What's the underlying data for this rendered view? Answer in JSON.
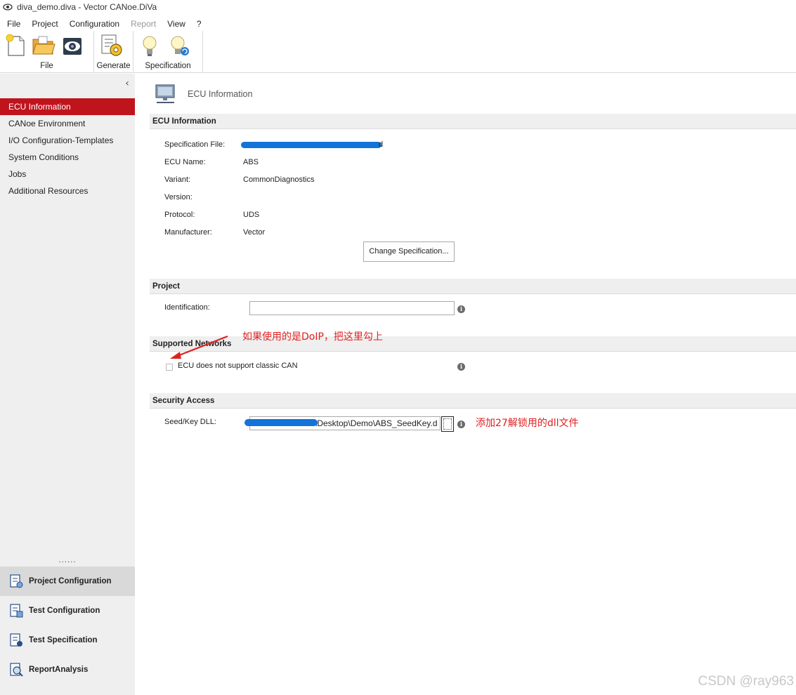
{
  "window": {
    "title": "diva_demo.diva - Vector CANoe.DiVa"
  },
  "menu": [
    {
      "label": "File"
    },
    {
      "label": "Project"
    },
    {
      "label": "Configuration"
    },
    {
      "label": "Report",
      "disabled": true
    },
    {
      "label": "View"
    },
    {
      "label": "?"
    }
  ],
  "ribbon": {
    "file_group": "File",
    "generate_group": "Generate",
    "spec_group": "Specification"
  },
  "sidebar": {
    "items": [
      {
        "label": "ECU Information",
        "active": true
      },
      {
        "label": "CANoe Environment"
      },
      {
        "label": "I/O Configuration-Templates"
      },
      {
        "label": "System Conditions"
      },
      {
        "label": "Jobs"
      },
      {
        "label": "Additional Resources"
      }
    ],
    "dots": "......",
    "bottom": [
      {
        "label": "Project Configuration",
        "icon": "project-config-icon",
        "active": true
      },
      {
        "label": "Test Configuration",
        "icon": "test-config-icon"
      },
      {
        "label": "Test Specification",
        "icon": "test-spec-icon"
      },
      {
        "label": "ReportAnalysis",
        "icon": "report-analysis-icon"
      }
    ]
  },
  "page": {
    "title": "ECU Information"
  },
  "ecu": {
    "header": "ECU Information",
    "spec_file_label": "Specification File:",
    "spec_file_value": "d",
    "ecu_name_label": "ECU Name:",
    "ecu_name_value": "ABS",
    "variant_label": "Variant:",
    "variant_value": "CommonDiagnostics",
    "version_label": "Version:",
    "version_value": "",
    "protocol_label": "Protocol:",
    "protocol_value": "UDS",
    "manufacturer_label": "Manufacturer:",
    "manufacturer_value": "Vector",
    "change_button": "Change Specification..."
  },
  "project": {
    "header": "Project",
    "identification_label": "Identification:",
    "identification_value": ""
  },
  "networks": {
    "header": "Supported Networks",
    "checkbox_label": "ECU does not support classic CAN",
    "checked": false
  },
  "security": {
    "header": "Security Access",
    "dll_label": "Seed/Key DLL:",
    "dll_value": "\\Desktop\\Demo\\ABS_SeedKey.d"
  },
  "annotations": {
    "doip_note": "如果使用的是DoIP，把这里勾上",
    "dll_note": "添加27解锁用的dll文件",
    "annotation_color": "#e02020",
    "redaction_color": "#1273d8"
  },
  "watermark": "CSDN @ray963",
  "colors": {
    "accent": "#c0141d",
    "sidebar_bg": "#efefef"
  }
}
